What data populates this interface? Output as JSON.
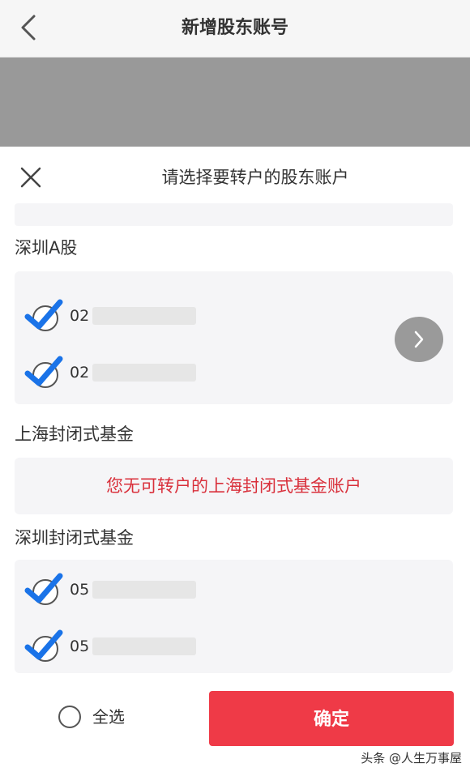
{
  "nav": {
    "title": "新增股东账号"
  },
  "sheet": {
    "title": "请选择要转户的股东账户",
    "sections": [
      {
        "title": "深圳A股",
        "accounts": [
          {
            "prefix": "02",
            "checked": true
          },
          {
            "prefix": "02",
            "checked": true
          }
        ]
      },
      {
        "title": "上海封闭式基金",
        "notice": "您无可转户的上海封闭式基金账户"
      },
      {
        "title": "深圳封闭式基金",
        "accounts": [
          {
            "prefix": "05",
            "checked": true
          },
          {
            "prefix": "05",
            "checked": true
          }
        ]
      }
    ]
  },
  "footer": {
    "select_all_label": "全选",
    "confirm_label": "确定"
  },
  "watermark": "头条 @人生万事屋",
  "colors": {
    "accent": "#ef3a47",
    "check": "#1a73e8",
    "notice": "#d9303b",
    "overlay": "#999999"
  }
}
